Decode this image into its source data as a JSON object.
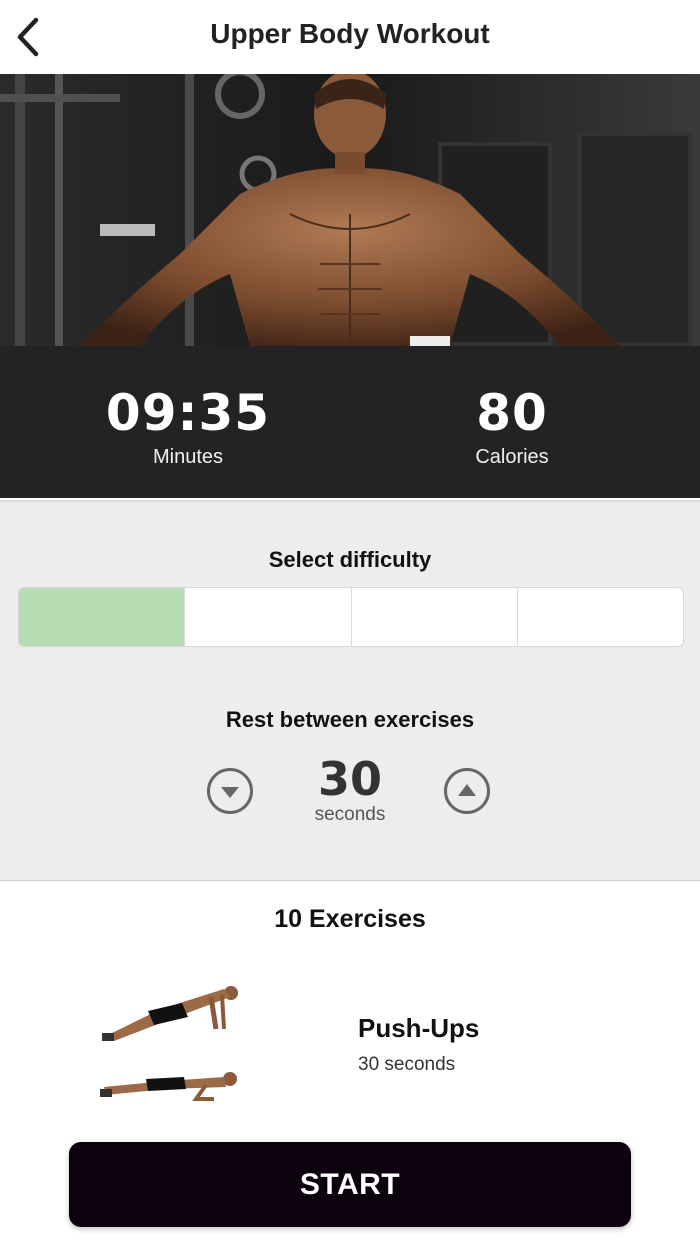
{
  "header": {
    "title": "Upper Body Workout",
    "back_icon": "chevron-left-icon"
  },
  "hero": {
    "image": "muscular-man-gym-photo"
  },
  "stats": {
    "duration_value": "09:35",
    "duration_label": "Minutes",
    "calories_value": "80",
    "calories_label": "Calories"
  },
  "difficulty": {
    "title": "Select difficulty",
    "levels": 4,
    "selected_level": 1,
    "selected_color": "#b6dcb4"
  },
  "rest": {
    "title": "Rest between exercises",
    "value": "30",
    "unit": "seconds",
    "decrease_icon": "circle-triangle-down-icon",
    "increase_icon": "circle-triangle-up-icon"
  },
  "exercises": {
    "header": "10 Exercises",
    "items": [
      {
        "name": "Push-Ups",
        "duration": "30 seconds",
        "thumbnail": "push-up-illustration"
      }
    ]
  },
  "start_button": {
    "label": "START",
    "color": "#0b020e"
  }
}
